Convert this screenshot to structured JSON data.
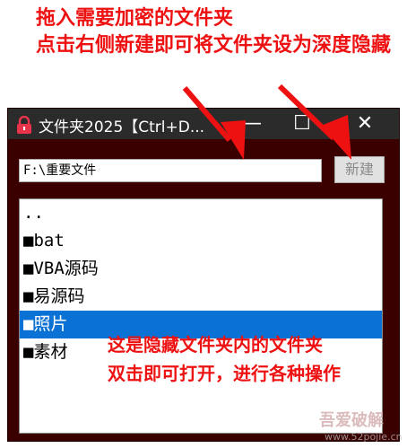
{
  "annotations": {
    "top_lines": [
      "拖入需要加密的文件夹",
      "点击右侧新建即可将文件夹设为深度隐藏"
    ],
    "bottom_lines": [
      "这是隐藏文件夹内的文件夹",
      "双击即可打开，进行各种操作"
    ]
  },
  "window": {
    "title": "文件夹2025【Ctrl+D...",
    "minimize_glyph": "—",
    "maximize_glyph": "☐",
    "close_glyph": "✕"
  },
  "path_input": {
    "value": "F:\\重要文件"
  },
  "new_button": {
    "label": "新建"
  },
  "list": {
    "items": [
      {
        "label": "..",
        "selected": false
      },
      {
        "label": "■bat",
        "selected": false
      },
      {
        "label": "■VBA源码",
        "selected": false
      },
      {
        "label": "■易源码",
        "selected": false
      },
      {
        "label": "■照片",
        "selected": true
      },
      {
        "label": "■素材",
        "selected": false
      }
    ]
  },
  "watermark": {
    "site_name": "吾爱破解",
    "url": "www.52pojie.cn"
  },
  "colors": {
    "annotation": "#ee1111",
    "window_background": "#3a0000",
    "titlebar": "#2b2b2b",
    "selection": "#0a72d4",
    "lock_icon": "#e8344a"
  }
}
